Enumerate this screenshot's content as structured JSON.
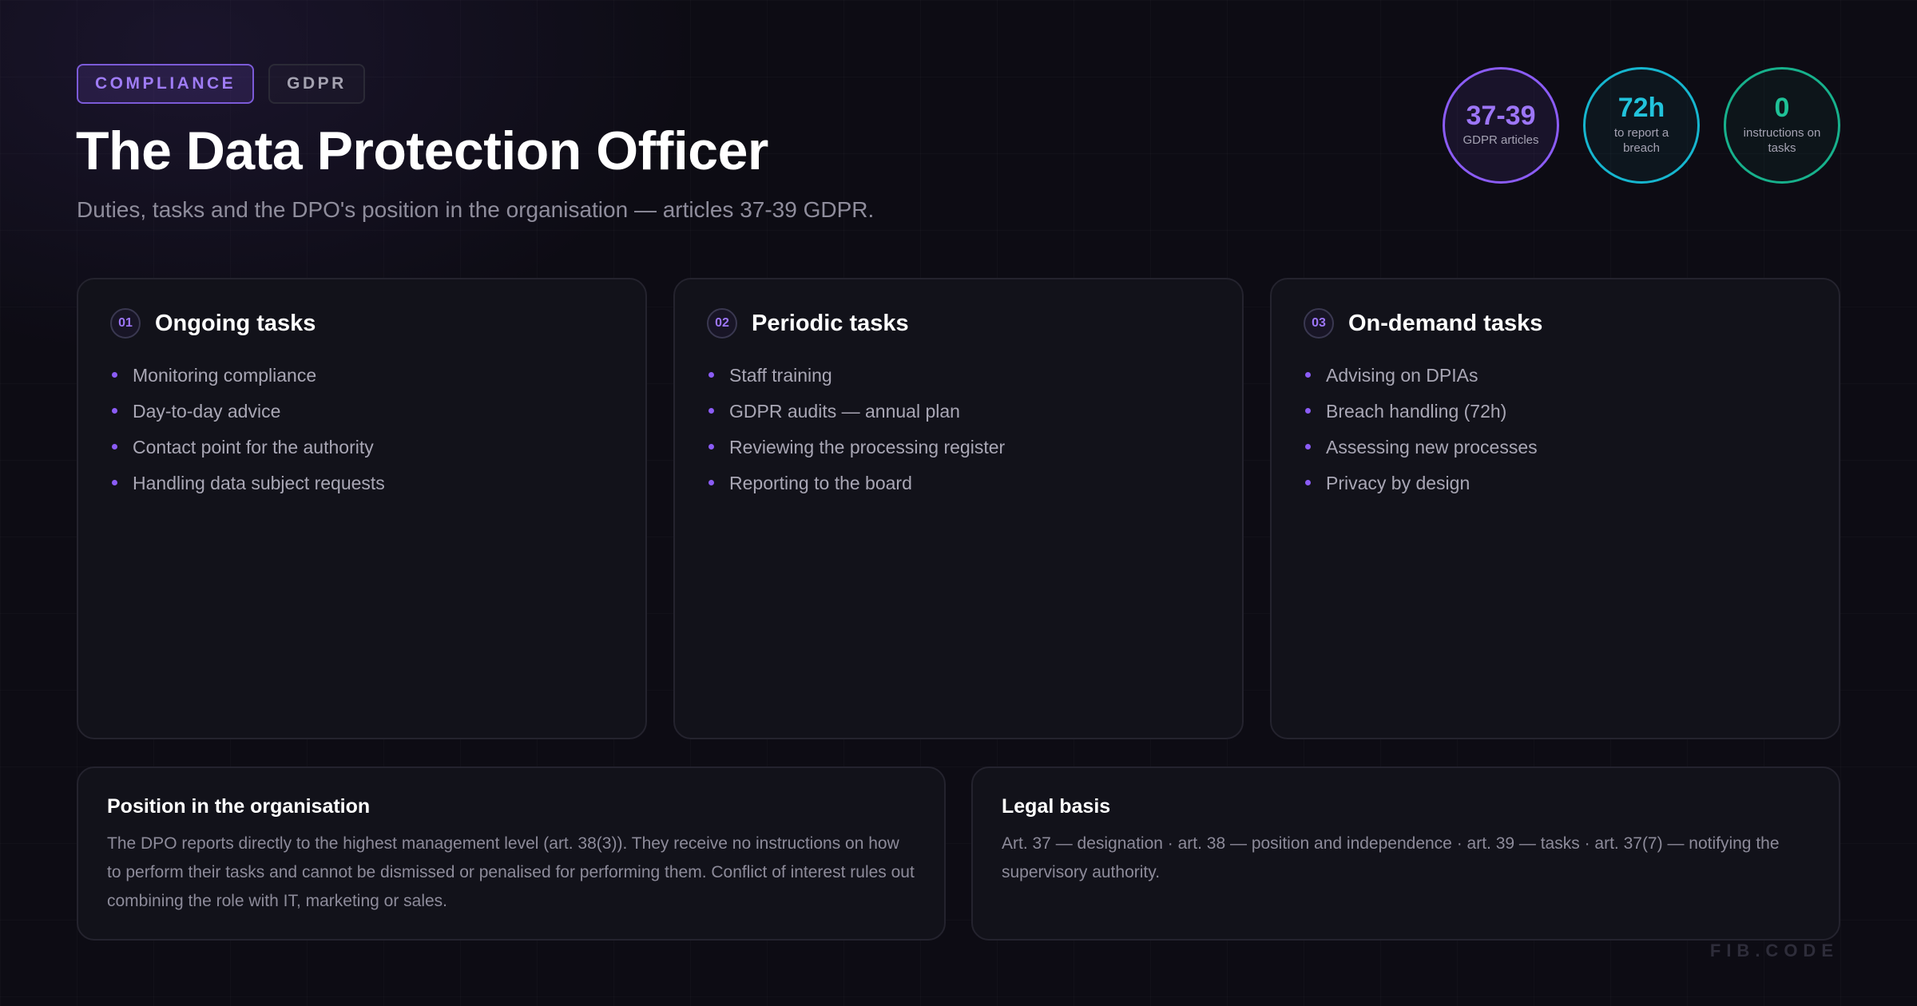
{
  "header": {
    "tags": [
      "COMPLIANCE",
      "GDPR"
    ],
    "title": "The Data Protection Officer",
    "subtitle": "Duties, tasks and the DPO's position in the organisation — articles 37-39 GDPR."
  },
  "stats": [
    {
      "value": "37-39",
      "label": "GDPR articles",
      "color": "#8b5cf6"
    },
    {
      "value": "72h",
      "label": "to report a breach",
      "color": "#16b6cf"
    },
    {
      "value": "0",
      "label": "instructions on tasks",
      "color": "#17b18c"
    }
  ],
  "task_cards": [
    {
      "number": "01",
      "title": "Ongoing tasks",
      "items": [
        "Monitoring compliance",
        "Day-to-day advice",
        "Contact point for the authority",
        "Handling data subject requests"
      ]
    },
    {
      "number": "02",
      "title": "Periodic tasks",
      "items": [
        "Staff training",
        "GDPR audits — annual plan",
        "Reviewing the processing register",
        "Reporting to the board"
      ]
    },
    {
      "number": "03",
      "title": "On-demand tasks",
      "items": [
        "Advising on DPIAs",
        "Breach handling (72h)",
        "Assessing new processes",
        "Privacy by design"
      ]
    }
  ],
  "info_cards": {
    "position": {
      "title": "Position in the organisation",
      "text": "The DPO reports directly to the highest management level (art. 38(3)). They receive no instructions on how to perform their tasks and cannot be dismissed or penalised for performing them. Conflict of interest rules out combining the role with IT, marketing or sales."
    },
    "legal": {
      "title": "Legal basis",
      "text": "Art. 37 — designation · art. 38 — position and independence · art. 39 — tasks · art. 37(7) — notifying the supervisory authority."
    }
  },
  "footer": {
    "watermark": "FIB.CODE"
  },
  "colors": {
    "accent": "#8b5cf6",
    "background": "#0d0c14",
    "card": "#12121a"
  }
}
